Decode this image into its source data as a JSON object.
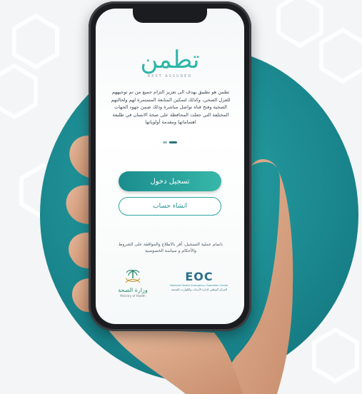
{
  "app": {
    "logo_text": "تطمن",
    "tagline": "REST ASSURED",
    "description": "تطمن هو تطبيق يهدف الى تعزيز التزام جميع من تم توجيههم للعزل الصحي، وكذلك لتمكين المتابعة المستمرة لهم ولحالتهم الصحية وفتح قناة تواصل مباشرة وذلك ضمن جهود الجهات المختلفة التي جعلت المحافظة على صحة الانسان في طليعة اهتماماتها ومقدمة أولوياتها"
  },
  "actions": {
    "login_label": "تسجيل دخول",
    "register_label": "انشاء حساب"
  },
  "terms_text": "باتمام عملية التسجيل، أقر بالاطلاع والموافقة على الشروط والأحكام و سياسة الخصوصية",
  "partners": {
    "moh_name": "وزارة الصحة",
    "moh_en": "Ministry of Health",
    "eoc_name": "EOC",
    "eoc_en": "National Health Emergency Operation Center",
    "eoc_ar": "المركز الوطني لإدارة الأزمات والكوارث الصحية"
  },
  "colors": {
    "brand_teal": "#2fb5a8",
    "circle": "#1d8d93",
    "button_gradient_start": "#1b8c8e",
    "button_gradient_end": "#36b8a9"
  },
  "pagination": {
    "active_index": 1,
    "total": 2
  }
}
